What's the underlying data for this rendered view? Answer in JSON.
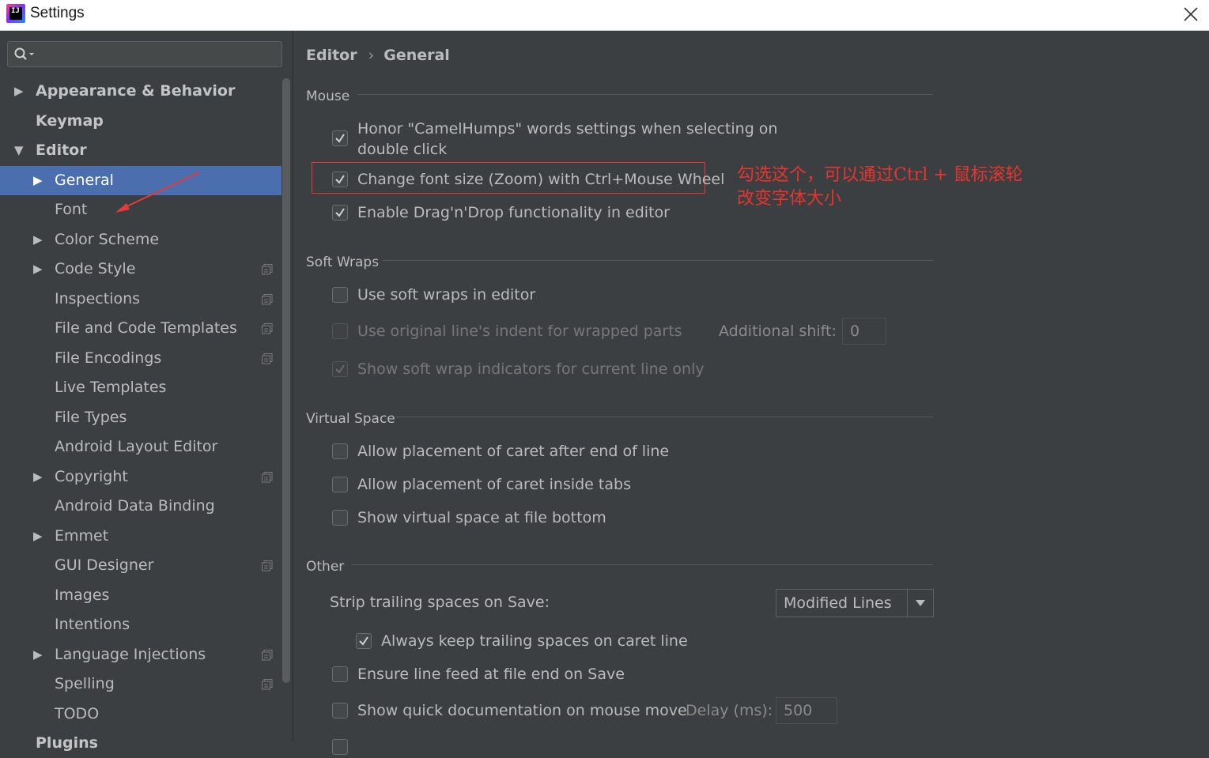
{
  "window": {
    "title": "Settings"
  },
  "search": {
    "placeholder": ""
  },
  "sidebar": {
    "items": [
      {
        "label": "Appearance & Behavior",
        "arrow": "▶"
      },
      {
        "label": "Keymap",
        "arrow": ""
      },
      {
        "label": "Editor",
        "arrow": "▼"
      },
      {
        "label": "General",
        "arrow": "▶"
      },
      {
        "label": "Font",
        "arrow": ""
      },
      {
        "label": "Color Scheme",
        "arrow": "▶"
      },
      {
        "label": "Code Style",
        "arrow": "▶"
      },
      {
        "label": "Inspections",
        "arrow": ""
      },
      {
        "label": "File and Code Templates",
        "arrow": ""
      },
      {
        "label": "File Encodings",
        "arrow": ""
      },
      {
        "label": "Live Templates",
        "arrow": ""
      },
      {
        "label": "File Types",
        "arrow": ""
      },
      {
        "label": "Android Layout Editor",
        "arrow": ""
      },
      {
        "label": "Copyright",
        "arrow": "▶"
      },
      {
        "label": "Android Data Binding",
        "arrow": ""
      },
      {
        "label": "Emmet",
        "arrow": "▶"
      },
      {
        "label": "GUI Designer",
        "arrow": ""
      },
      {
        "label": "Images",
        "arrow": ""
      },
      {
        "label": "Intentions",
        "arrow": ""
      },
      {
        "label": "Language Injections",
        "arrow": "▶"
      },
      {
        "label": "Spelling",
        "arrow": ""
      },
      {
        "label": "TODO",
        "arrow": ""
      },
      {
        "label": "Plugins",
        "arrow": ""
      }
    ]
  },
  "breadcrumb": {
    "parent": "Editor",
    "separator": "›",
    "current": "General"
  },
  "sections": {
    "mouse": {
      "title": "Mouse",
      "camel_humps_line1": "Honor \"CamelHumps\" words settings when selecting on",
      "camel_humps_line2": "double click",
      "zoom": "Change font size (Zoom) with Ctrl+Mouse Wheel",
      "drag_drop": "Enable Drag'n'Drop functionality in editor"
    },
    "soft_wraps": {
      "title": "Soft Wraps",
      "use_soft_wraps": "Use soft wraps in editor",
      "original_indent": "Use original line's indent for wrapped parts",
      "additional_shift_label": "Additional shift:",
      "additional_shift_value": "0",
      "show_indicators": "Show soft wrap indicators for current line only"
    },
    "virtual_space": {
      "title": "Virtual Space",
      "after_end": "Allow placement of caret after end of line",
      "inside_tabs": "Allow placement of caret inside tabs",
      "file_bottom": "Show virtual space at file bottom"
    },
    "other": {
      "title": "Other",
      "strip_label": "Strip trailing spaces on Save:",
      "strip_value": "Modified Lines",
      "keep_trailing": "Always keep trailing spaces on caret line",
      "line_feed": "Ensure line feed at file end on Save",
      "quick_doc": "Show quick documentation on mouse move",
      "delay_label": "Delay (ms):",
      "delay_value": "500"
    }
  },
  "annotation": {
    "line1": "勾选这个，可以通过Ctrl + 鼠标滚轮",
    "line2": "改变字体大小"
  },
  "colors": {
    "background": "#3c3f41",
    "selection": "#4b6eaf",
    "annotation": "#e8342f",
    "text": "#bbbbbb"
  }
}
